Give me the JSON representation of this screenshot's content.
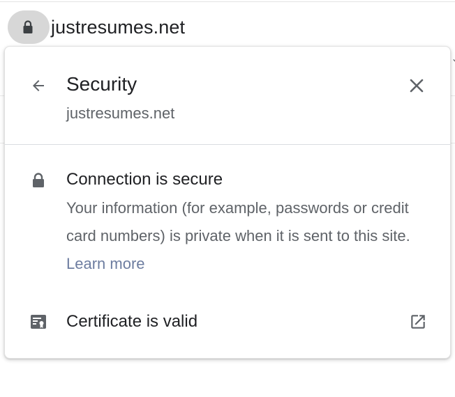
{
  "omnibox": {
    "url": "justresumes.net",
    "lock_icon": "lock-icon"
  },
  "popup": {
    "back_icon": "arrow-back-icon",
    "title": "Security",
    "subtitle": "justresumes.net",
    "close_icon": "close-icon",
    "connection": {
      "icon": "lock-icon",
      "title": "Connection is secure",
      "description": "Your information (for example, passwords or credit card numbers) is private when it is sent to this site.",
      "learn_more": "Learn more"
    },
    "certificate": {
      "icon": "certificate-icon",
      "label": "Certificate is valid",
      "action_icon": "open-in-new-icon"
    }
  },
  "colors": {
    "text_primary": "#202124",
    "text_secondary": "#5f6368",
    "link": "#6d7da0",
    "chip_background": "#d7d7d7",
    "divider": "#dadce0"
  }
}
